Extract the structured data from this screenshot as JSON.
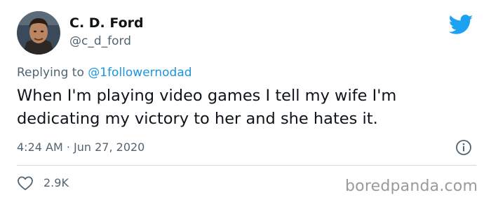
{
  "author": {
    "name": "C. D. Ford",
    "handle": "@c_d_ford"
  },
  "reply": {
    "prefix": "Replying to ",
    "mention": "@1followernodad"
  },
  "tweet": {
    "text": "When I'm playing video games I tell my wife I'm dedicating my victory to her and she hates it.",
    "timestamp": "4:24 AM · Jun 27, 2020"
  },
  "stats": {
    "likes": "2.9K"
  },
  "watermark": "boredpanda.com",
  "icons": {
    "brand": "twitter-bird-icon",
    "info": "info-icon",
    "like": "heart-icon"
  },
  "colors": {
    "accent": "#1da1f2",
    "mention": "#1b95e0",
    "secondary_text": "#536471",
    "primary_text": "#0f1419",
    "divider": "#cfd9de"
  }
}
